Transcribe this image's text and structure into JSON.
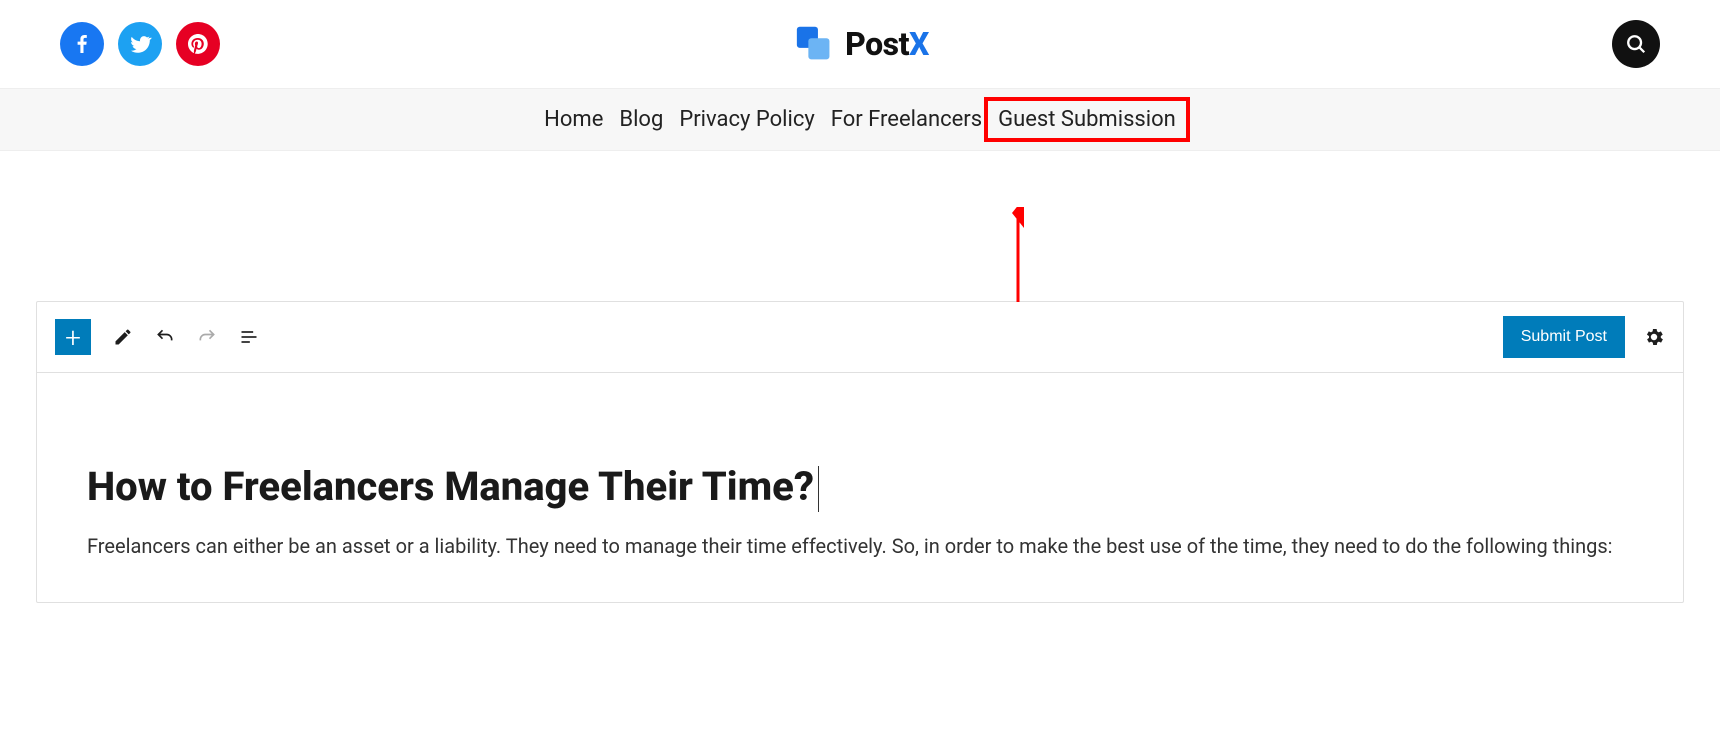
{
  "brand": {
    "name_main": "Post",
    "name_accent": "X"
  },
  "nav": {
    "items": [
      {
        "label": "Home"
      },
      {
        "label": "Blog"
      },
      {
        "label": "Privacy Policy"
      },
      {
        "label": "For Freelancers"
      },
      {
        "label": "Guest Submission",
        "highlighted": true
      }
    ]
  },
  "editor": {
    "toolbar": {
      "submit_label": "Submit Post"
    },
    "content": {
      "title": "How to Freelancers Manage Their Time?",
      "body": "Freelancers can either be an asset or a liability. They need to manage their time effectively. So, in order to make the best use of the time, they need to do the following things:"
    }
  }
}
